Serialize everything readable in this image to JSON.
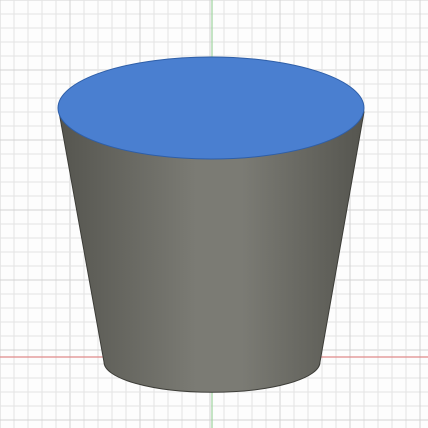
{
  "viewport": {
    "kind": "3d-modeling-viewport",
    "grid": true,
    "model": "tapered-cylinder",
    "selected_face": "top-face"
  },
  "colors": {
    "background": "#fdfdfd",
    "grid_minor": "#e4e4e4",
    "grid_major": "#d2d2d2",
    "axis_x": "#e08a8a",
    "axis_y": "#9fd49f",
    "body_dark": "#55554f",
    "body_light": "#7b7b74",
    "top_face": "#4a7fd0",
    "top_face_edge": "#2f5fa8",
    "outline": "#3d3d38"
  }
}
